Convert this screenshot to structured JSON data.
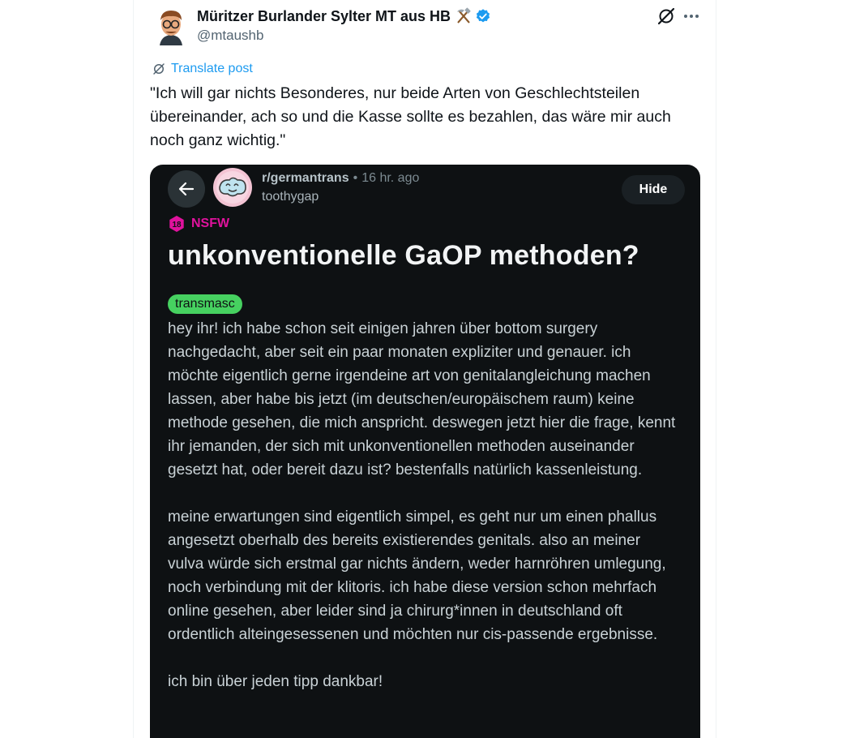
{
  "tweet": {
    "author": {
      "display_name": "Müritzer Burlander Sylter MT aus HB",
      "handle": "@mtaushb",
      "avatar_icon": "memoji-avatar-icon",
      "name_emoji": "hammer-and-pick-icon",
      "verified_icon": "verified-badge-icon",
      "verified_color": "#1d9bf0"
    },
    "actions": {
      "grok_icon": "grok-icon",
      "more_icon": "more-options-icon"
    },
    "translate_label": "Translate post",
    "text": "\"Ich will gar nichts Besonderes, nur beide Arten von Geschlechtsteilen übereinander, ach so und die Kasse sollte es bezahlen, das wäre mir auch noch ganz wichtig.\""
  },
  "reddit_screenshot": {
    "back_icon": "arrow-left-icon",
    "subreddit": "r/germantrans",
    "separator": "•",
    "time": "16 hr. ago",
    "username": "toothygap",
    "hide_label": "Hide",
    "nsfw_badge": "18",
    "nsfw_label": "NSFW",
    "title": "unkonventionelle GaOP methoden?",
    "flair": "transmasc",
    "flair_color": "#46d160",
    "paragraphs": [
      "hey ihr! ich habe schon seit einigen jahren über bottom surgery nachgedacht, aber seit ein paar monaten expliziter und genauer. ich möchte eigentlich gerne irgendeine art von genitalangleichung machen lassen, aber habe bis jetzt (im deutschen/europäischem raum) keine methode gesehen, die mich anspricht. deswegen jetzt hier die frage, kennt ihr jemanden, der sich mit unkonventionellen methoden auseinander gesetzt hat, oder bereit dazu ist? bestenfalls natürlich kassenleistung.",
      "meine erwartungen sind eigentlich simpel, es geht nur um einen phallus angesetzt oberhalb des bereits existierendes genitals. also an meiner vulva würde sich erstmal gar nichts ändern, weder harnröhren umlegung, noch verbindung mit der klitoris. ich habe diese version schon mehrfach online gesehen, aber leider sind ja chirurg*innen in deutschland oft ordentlich alteingesessenen und möchten nur cis-passende ergebnisse.",
      "ich bin über jeden tipp dankbar!"
    ]
  }
}
